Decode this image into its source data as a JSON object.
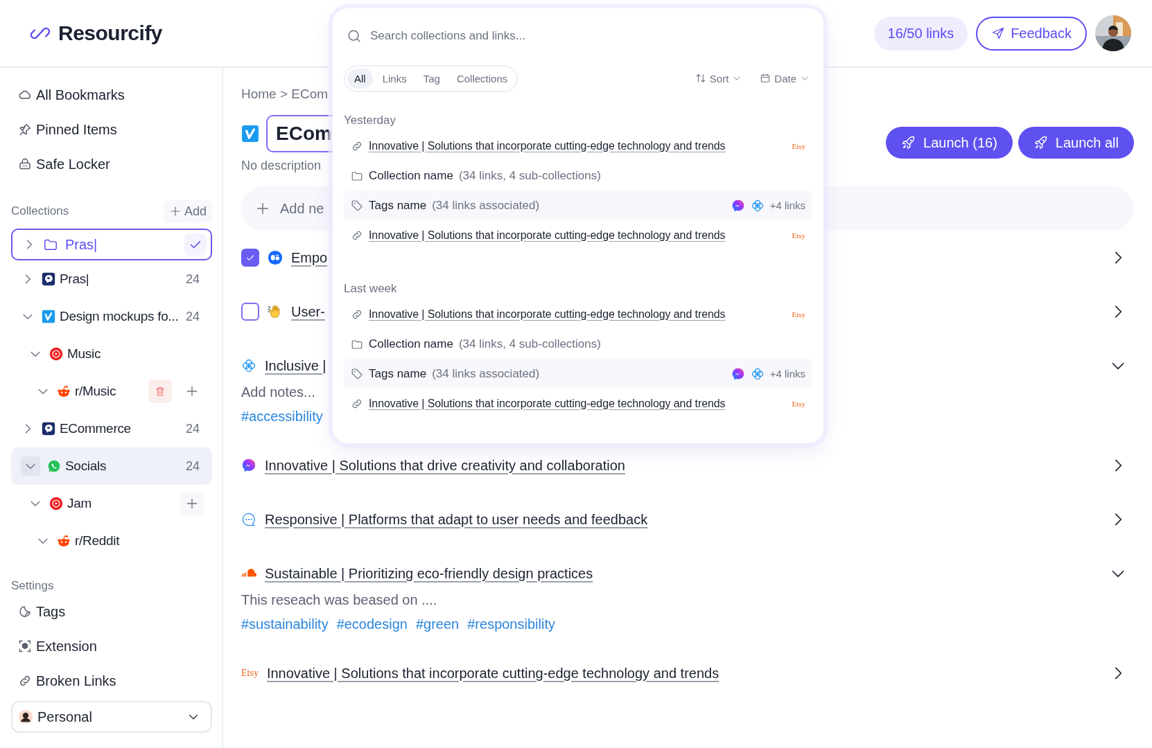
{
  "app": {
    "name": "Resourcify"
  },
  "header": {
    "usage": "16/50 links",
    "feedback": "Feedback"
  },
  "sidebar": {
    "nav": [
      {
        "label": "All Bookmarks"
      },
      {
        "label": "Pinned Items"
      },
      {
        "label": "Safe Locker"
      }
    ]
  },
  "collections": {
    "title": "Collections",
    "add": "Add",
    "new_item": {
      "value": "Pras|"
    },
    "tree": [
      {
        "label": "Pras|",
        "count": "24",
        "expanded": false,
        "selected": false,
        "delete_button": false,
        "add_button": false
      },
      {
        "label": "Design mockups fo...",
        "count": "24",
        "expanded": true,
        "selected": false,
        "delete_button": false,
        "add_button": false,
        "children": [
          {
            "label": "Music",
            "expanded": true,
            "selected": false,
            "delete_button": false,
            "add_button": false,
            "children": [
              {
                "label": "r/Music",
                "expanded": true,
                "selected": false,
                "delete_button": true,
                "add_button": true
              }
            ]
          }
        ]
      },
      {
        "label": "ECommerce",
        "count": "24",
        "expanded": false,
        "selected": false,
        "delete_button": false,
        "add_button": false
      },
      {
        "label": "Socials",
        "count": "24",
        "expanded": true,
        "selected": true,
        "delete_button": false,
        "add_button": false,
        "children": [
          {
            "label": "Jam",
            "expanded": true,
            "selected": false,
            "delete_button": false,
            "add_button": true,
            "children": [
              {
                "label": "r/Reddit",
                "expanded": true,
                "selected": false,
                "delete_button": false,
                "add_button": false
              }
            ]
          }
        ]
      }
    ]
  },
  "settings": {
    "title": "Settings",
    "items": [
      {
        "label": "Tags"
      },
      {
        "label": "Extension"
      },
      {
        "label": "Broken Links"
      }
    ]
  },
  "workspace": {
    "label": "Personal"
  },
  "main": {
    "breadcrumb": "Home > ECom",
    "title": "ECom",
    "description": "No description",
    "add_new": "Add ne",
    "launch": [
      "Launch (16)",
      "Launch all"
    ],
    "links": [
      {
        "kind": "checkable",
        "checked": true,
        "title": "Empo",
        "expanded": false
      },
      {
        "kind": "checkable",
        "checked": false,
        "title": "User-",
        "expanded": false
      },
      {
        "kind": "plain",
        "title": "Inclusive |",
        "expanded": true,
        "notes": "Add notes...",
        "tags": [
          "#accessibility"
        ]
      },
      {
        "kind": "plain",
        "title": "Innovative | Solutions that drive creativity and collaboration",
        "expanded": false
      },
      {
        "kind": "plain",
        "title": "Responsive | Platforms that adapt to user needs and feedback",
        "expanded": false
      },
      {
        "kind": "plain",
        "title": "Sustainable | Prioritizing eco-friendly design practices",
        "expanded": true,
        "notes": "This reseach was beased on ....",
        "tags": [
          "#sustainability",
          "#ecodesign",
          "#green",
          "#responsibility"
        ]
      },
      {
        "kind": "plain",
        "source": "Etsy",
        "title": "Innovative | Solutions that incorporate cutting-edge technology and trends",
        "expanded": false
      }
    ]
  },
  "search": {
    "placeholder": "Search collections and links...",
    "filters": [
      {
        "label": "All",
        "selected": true
      },
      {
        "label": "Links",
        "selected": false
      },
      {
        "label": "Tag",
        "selected": false
      },
      {
        "label": "Collections",
        "selected": false
      }
    ],
    "sort": "Sort",
    "date": "Date",
    "groups": [
      {
        "title": "Yesterday",
        "results": [
          {
            "kind": "link",
            "title": "Innovative | Solutions that incorporate cutting-edge technology and trends",
            "source": "Etsy"
          },
          {
            "kind": "collection",
            "name": "Collection name",
            "detail": "(34 links, 4 sub-collections)"
          },
          {
            "kind": "tag",
            "name": "Tags name",
            "detail": "(34 links associated)",
            "more": "+4 links"
          },
          {
            "kind": "link",
            "title": "Innovative | Solutions that incorporate cutting-edge technology and trends",
            "source": "Etsy"
          }
        ]
      },
      {
        "title": "Last week",
        "results": [
          {
            "kind": "link",
            "title": "Innovative | Solutions that incorporate cutting-edge technology and trends",
            "source": "Etsy"
          },
          {
            "kind": "collection",
            "name": "Collection name",
            "detail": "(34 links, 4 sub-collections)"
          },
          {
            "kind": "tag",
            "name": "Tags name",
            "detail": "(34 links associated)",
            "more": "+4 links"
          },
          {
            "kind": "link",
            "title": "Innovative | Solutions that incorporate cutting-edge technology and trends",
            "source": "Etsy"
          }
        ]
      }
    ]
  }
}
